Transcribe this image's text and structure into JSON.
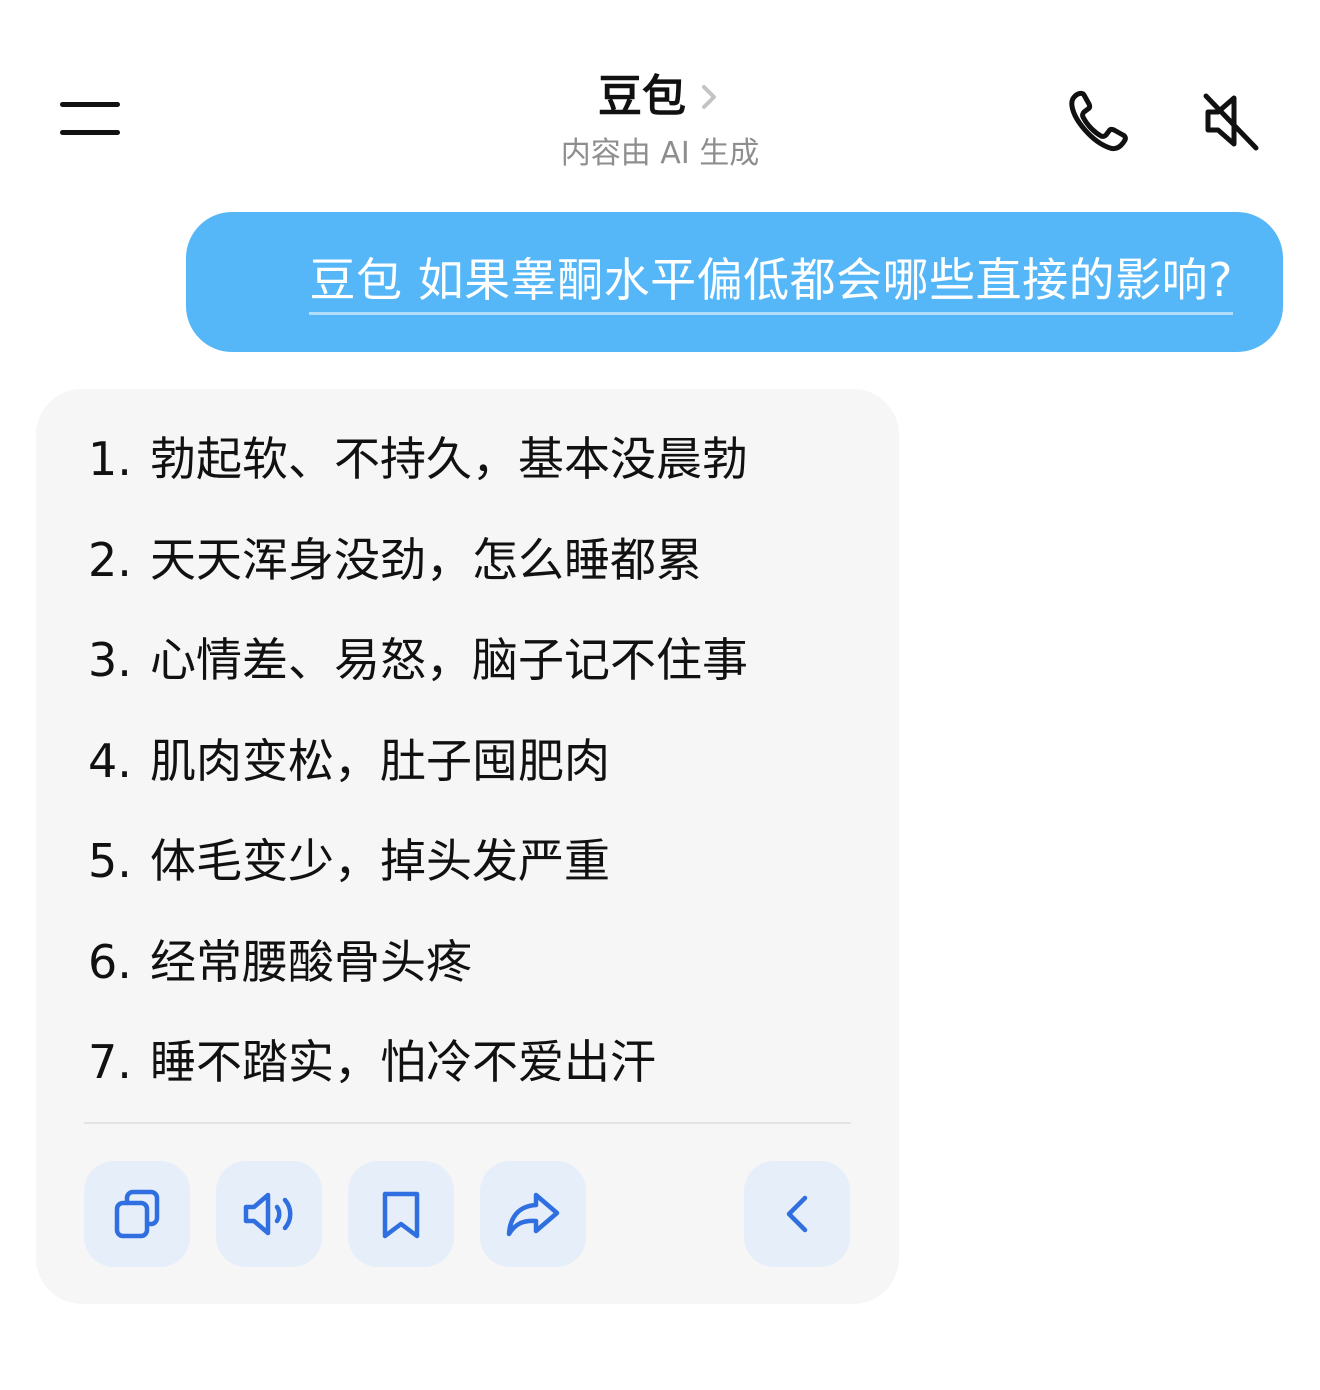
{
  "header": {
    "menu_icon": "hamburger-menu-icon",
    "bot_name": "豆包",
    "subtitle": "内容由 AI 生成",
    "actions": [
      {
        "name": "phone-icon"
      },
      {
        "name": "mute-icon"
      }
    ]
  },
  "conversation": {
    "user_message": "豆包 如果睾酮水平偏低都会哪些直接的影响?",
    "bot_reply": {
      "items": [
        {
          "num": "1.",
          "text": "勃起软、不持久，基本没晨勃"
        },
        {
          "num": "2.",
          "text": "天天浑身没劲，怎么睡都累"
        },
        {
          "num": "3.",
          "text": "心情差、易怒，脑子记不住事"
        },
        {
          "num": "4.",
          "text": "肌肉变松，肚子囤肥肉"
        },
        {
          "num": "5.",
          "text": "体毛变少，掉头发严重"
        },
        {
          "num": "6.",
          "text": "经常腰酸骨头疼"
        },
        {
          "num": "7.",
          "text": "睡不踏实，怕冷不爱出汗"
        }
      ],
      "action_icons": [
        "copy-icon",
        "speaker-icon",
        "bookmark-icon",
        "share-icon",
        "chevron-left-icon"
      ]
    }
  },
  "colors": {
    "user_bubble": "#55b6f8",
    "bot_bubble": "#f6f6f6",
    "action_button_bg": "#e6eef9",
    "action_icon": "#2f6fe0",
    "subtitle_text": "#8e8e8e"
  }
}
